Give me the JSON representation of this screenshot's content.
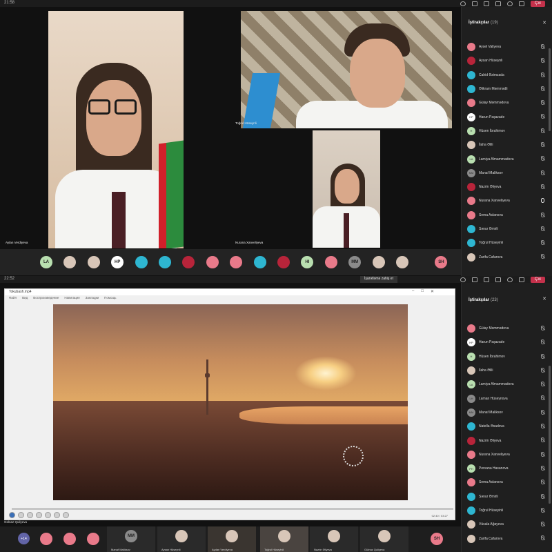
{
  "shot1": {
    "clock": "21:58",
    "leave_label": "Çıx",
    "panel": {
      "title": "İştirakçılar",
      "count": "(19)",
      "participants": [
        {
          "name": "Aysel Valiyeva",
          "initials": "",
          "color": "#e97a8a",
          "mic": "muted"
        },
        {
          "name": "Aysan Hüseynli",
          "initials": "",
          "color": "#b8243a",
          "mic": "muted"
        },
        {
          "name": "Cahid Əzimzada",
          "initials": "",
          "color": "#2eb6d1",
          "mic": "muted"
        },
        {
          "name": "Əlikram Məmmədli",
          "initials": "",
          "color": "#2eb6d1",
          "mic": "muted"
        },
        {
          "name": "Gülay Məmmədova",
          "initials": "",
          "color": "#e97a8a",
          "mic": "muted"
        },
        {
          "name": "Harun Paşazade",
          "initials": "HP",
          "color": "#ffffff",
          "mic": "muted"
        },
        {
          "name": "Hüsen İbrahimov",
          "initials": "H",
          "color": "#b9dfb0",
          "mic": "muted"
        },
        {
          "name": "İlaha Əlili",
          "initials": "",
          "color": "#d8c6b8",
          "mic": "muted"
        },
        {
          "name": "Lamiya Almammadova",
          "initials": "LA",
          "color": "#b9dfb0",
          "mic": "muted"
        },
        {
          "name": "Manaf Maliksov",
          "initials": "MM",
          "color": "#8a8a8a",
          "mic": "muted"
        },
        {
          "name": "Nazrin Əliyeva",
          "initials": "",
          "color": "#b8243a",
          "mic": "muted"
        },
        {
          "name": "Nurana Xanveliyeva",
          "initials": "",
          "color": "#e97a8a",
          "mic": "on"
        },
        {
          "name": "Sema Aslanova",
          "initials": "",
          "color": "#e97a8a",
          "mic": "muted"
        },
        {
          "name": "Sənur Əmirli",
          "initials": "",
          "color": "#2eb6d1",
          "mic": "muted"
        },
        {
          "name": "Toğrul Hüseyinli",
          "initials": "",
          "color": "#2eb6d1",
          "mic": "muted"
        },
        {
          "name": "Zarifa Cafarova",
          "initials": "",
          "color": "#d8c6b8",
          "mic": "muted"
        }
      ]
    },
    "tiles": {
      "a_name": "Aytan Verdiyeva",
      "b_name": "Toğrul Hüseynli",
      "c_name": "Nurana Xanveliyeva"
    },
    "callbar": [
      {
        "initials": "LA",
        "color": "#b9dfb0"
      },
      {
        "initials": "",
        "color": "#d8c6b8"
      },
      {
        "initials": "",
        "color": "#d8c6b8"
      },
      {
        "initials": "HP",
        "color": "#ffffff"
      },
      {
        "initials": "",
        "color": "#2eb6d1"
      },
      {
        "initials": "",
        "color": "#2eb6d1"
      },
      {
        "initials": "",
        "color": "#b8243a"
      },
      {
        "initials": "",
        "color": "#e97a8a"
      },
      {
        "initials": "",
        "color": "#e97a8a"
      },
      {
        "initials": "",
        "color": "#2eb6d1"
      },
      {
        "initials": "",
        "color": "#b8243a"
      },
      {
        "initials": "HI",
        "color": "#b9dfb0"
      },
      {
        "initials": "",
        "color": "#e97a8a"
      },
      {
        "initials": "MM",
        "color": "#8a8a8a"
      },
      {
        "initials": "",
        "color": "#d8c6b8"
      },
      {
        "initials": "",
        "color": "#d8c6b8"
      },
      {
        "initials": "SH",
        "color": "#e97a8a"
      }
    ]
  },
  "shot2": {
    "clock": "22:52",
    "raise_hand": "İşarətləmə zahiş et",
    "leave_label": "Çıx",
    "player": {
      "file": "Tokubash.mp4",
      "menu": [
        "Файл",
        "Вид",
        "Воспроизведение",
        "Навигация",
        "Закладки",
        "Помощь"
      ],
      "time": "02:40 / 03:27"
    },
    "caption": "Gülnaz Quliyeva",
    "panel": {
      "title": "İştirakçılar",
      "count": "(23)",
      "participants": [
        {
          "name": "Gülay Məmmədova",
          "initials": "",
          "color": "#e97a8a",
          "mic": "muted"
        },
        {
          "name": "Harun Paşazade",
          "initials": "HP",
          "color": "#ffffff",
          "mic": "muted"
        },
        {
          "name": "Hüsen İbrahimov",
          "initials": "H",
          "color": "#b9dfb0",
          "mic": "muted"
        },
        {
          "name": "İlaha Əlili",
          "initials": "",
          "color": "#d8c6b8",
          "mic": "muted"
        },
        {
          "name": "Lamiya Almammadova",
          "initials": "LA",
          "color": "#b9dfb0",
          "mic": "muted"
        },
        {
          "name": "Laman Hüseynova",
          "initials": "LH",
          "color": "#8a8a8a",
          "mic": "muted"
        },
        {
          "name": "Manaf Maliksov",
          "initials": "MM",
          "color": "#8a8a8a",
          "mic": "muted"
        },
        {
          "name": "Natella Əsadova",
          "initials": "",
          "color": "#2eb6d1",
          "mic": "muted"
        },
        {
          "name": "Nazrin Əliyeva",
          "initials": "",
          "color": "#b8243a",
          "mic": "muted"
        },
        {
          "name": "Nurana Xanveliyeva",
          "initials": "",
          "color": "#e97a8a",
          "mic": "muted"
        },
        {
          "name": "Pervana Hasanova",
          "initials": "PH",
          "color": "#b9dfb0",
          "mic": "muted"
        },
        {
          "name": "Sema Aslanova",
          "initials": "",
          "color": "#e97a8a",
          "mic": "muted"
        },
        {
          "name": "Sənur Əmirli",
          "initials": "",
          "color": "#2eb6d1",
          "mic": "muted"
        },
        {
          "name": "Toğrul Hüseyinli",
          "initials": "",
          "color": "#2eb6d1",
          "mic": "muted"
        },
        {
          "name": "Vüsala Ağayeva",
          "initials": "",
          "color": "#d8c6b8",
          "mic": "muted"
        },
        {
          "name": "Zarifa Cafarova",
          "initials": "",
          "color": "#d8c6b8",
          "mic": "muted"
        }
      ]
    },
    "strip": {
      "more": "+14",
      "tiles": [
        {
          "name": "Manaf Maliksov",
          "initials": "MM"
        },
        {
          "name": "Aysan Hüseynli",
          "initials": ""
        },
        {
          "name": "Aydan Verdiyeva",
          "initials": ""
        },
        {
          "name": "Toğrul Hüseyinli",
          "initials": ""
        },
        {
          "name": "Nazrin Əliyeva",
          "initials": ""
        },
        {
          "name": "Gülnaz Quliyeva",
          "initials": ""
        }
      ],
      "end_avatar": "SH"
    }
  }
}
